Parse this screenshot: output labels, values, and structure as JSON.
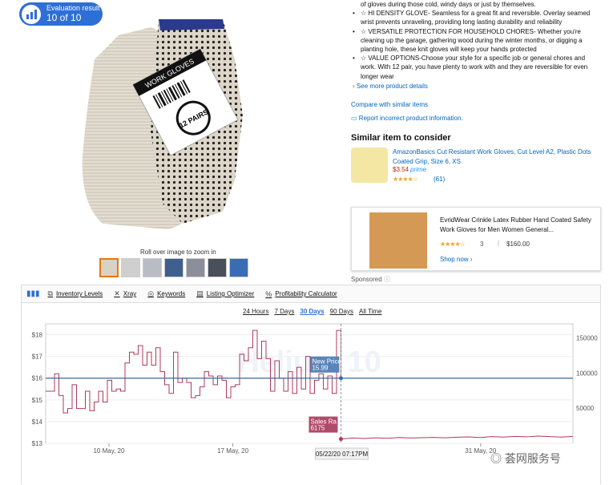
{
  "badge": {
    "line1": "Evaluation result",
    "line2": "10 of 10"
  },
  "image": {
    "roll_over": "Roll over image to zoom in",
    "label_text": "WORK GLOVES",
    "pairs_text": "12 PAIRS"
  },
  "bullets": [
    "of gloves during those cold, windy days or just by themselves.",
    "☆ HI DENSITY GLOVE- Seamless for a great fit and reversible. Overlay seamed wrist prevents unraveling, providing long lasting durability and reliability",
    "☆ VERSATILE PROTECTION FOR HOUSEHOLD CHORES- Whether you're cleaning up the garage, gathering wood during the winter months, or digging a planting hole, these knit gloves will keep your hands protected",
    "☆ VALUE OPTIONS-Choose your style for a specific job or general chores and work. With 12 pair, you have plenty to work with and they are reversible for even longer wear"
  ],
  "links": {
    "see_more": "See more product details",
    "compare": "Compare with similar items",
    "report": "Report incorrect product information."
  },
  "similar": {
    "heading": "Similar item to consider",
    "title": "AmazonBasics Cut Resistant Work Gloves, Cut Level A2, Plastic Dots Coated Grip, Size 6, XS",
    "price": "$3.54",
    "prime": "prime",
    "stars": "★★★★☆",
    "reviews": "(61)"
  },
  "ad": {
    "title": "EvridWear Crinkle Latex Rubber Hand Coated Safety Work Gloves for Men Women General...",
    "stars": "★★★★☆",
    "count": "3",
    "sep": "|",
    "price": "$160.00",
    "shop": "Shop now ›"
  },
  "sponsored": "Sponsored",
  "toolbar": {
    "tabs": [
      "Inventory Levels",
      "Xray",
      "Keywords",
      "Listing Optimizer",
      "Profitability Calculator"
    ]
  },
  "ranges": [
    "24 Hours",
    "7 Days",
    "30 Days",
    "90 Days",
    "All Time"
  ],
  "active_range": "30 Days",
  "chart_data": {
    "type": "line",
    "watermark": "Helium 10",
    "y_left_ticks": [
      "$18",
      "$17",
      "$16",
      "$15",
      "$14",
      "$13"
    ],
    "y_right_ticks": [
      "150000",
      "100000",
      "50000"
    ],
    "x_ticks": [
      "10 May, 20",
      "17 May, 20",
      "31 May, 20"
    ],
    "ylim_left": [
      13,
      18.5
    ],
    "ylim_right": [
      0,
      170000
    ],
    "price_series": {
      "name": "New Price",
      "values": [
        15.4,
        15.4,
        16.2,
        15.2,
        14.4,
        14.6,
        15.7,
        14.6,
        14.6,
        15.4,
        14.5,
        14.9,
        15.4,
        14.9,
        15.9,
        15.4,
        15.5,
        15.4,
        16.7,
        17.2,
        17.1,
        17.5,
        16.6,
        17.2,
        16.6,
        17.4,
        16.3,
        15.7,
        15.3,
        17.2,
        15.8,
        16.0,
        15.8,
        15.1,
        15.2,
        15.6,
        16.3,
        16.1,
        15.7,
        16.1,
        15.9,
        15.1,
        15.6,
        15.7,
        17.1,
        16.8,
        17.4,
        18.2,
        16.9,
        17.7,
        16.9,
        15.4,
        16.8,
        16.0,
        15.4,
        16.3,
        15.3,
        16.5,
        15.5,
        17.0,
        15.3,
        15.9,
        16.2,
        15.5,
        16.1,
        15.3,
        18.2,
        15.99
      ]
    },
    "sales_rank_series": {
      "name": "Sales Rank",
      "values": [
        6175,
        7500,
        6900,
        7800,
        7100,
        8200,
        7600,
        8000,
        8400,
        7900,
        8700,
        9100,
        8300,
        9500,
        8800,
        9900,
        9200,
        10300,
        9600,
        8900,
        9800
      ]
    },
    "tooltip_price": {
      "label": "New Price",
      "value": "15.99"
    },
    "tooltip_rank": {
      "label": "Sales Ra",
      "value": "6175"
    },
    "cursor_date": "05/22/20 07:17PM"
  },
  "watermark_footer": "荟网服务号"
}
